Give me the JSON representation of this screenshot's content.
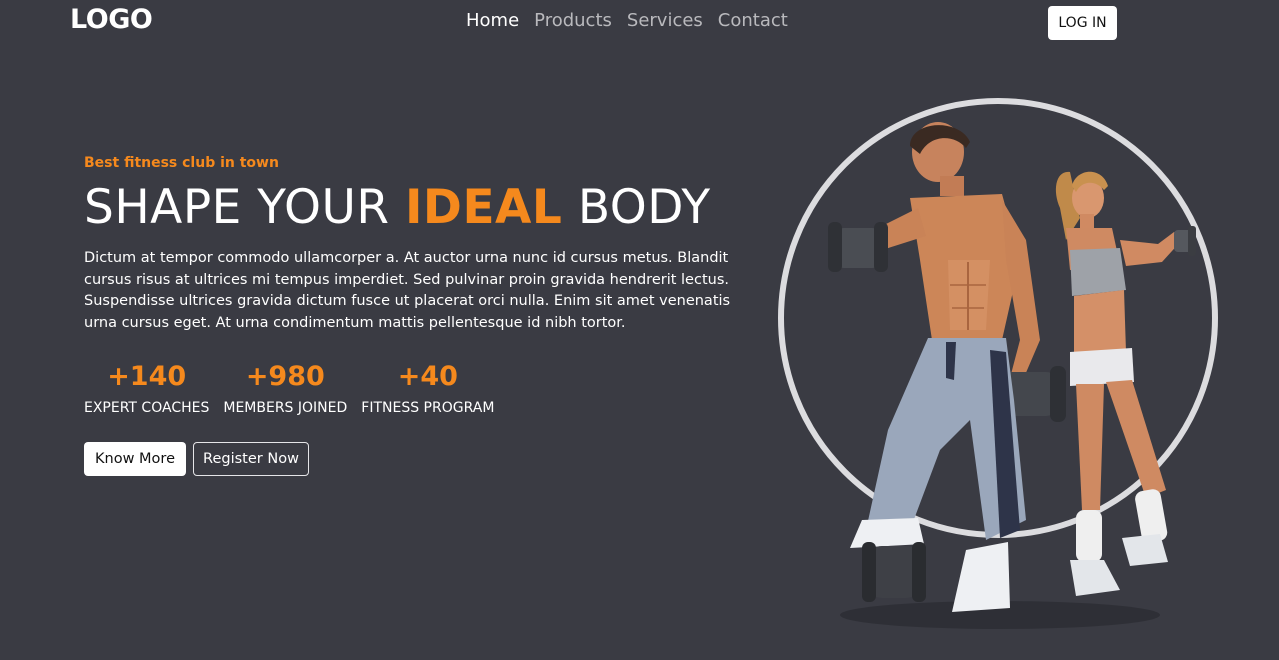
{
  "header": {
    "logo": "LOGO",
    "nav": [
      {
        "label": "Home",
        "active": true
      },
      {
        "label": "Products",
        "active": false
      },
      {
        "label": "Services",
        "active": false
      },
      {
        "label": "Contact",
        "active": false
      }
    ],
    "login_label": "LOG IN"
  },
  "hero": {
    "tagline": "Best fitness club in town",
    "headline_start": "SHAPE YOUR ",
    "headline_accent": "IDEAL",
    "headline_end": " BODY",
    "description": "Dictum at tempor commodo ullamcorper a. At auctor urna nunc id cursus metus. Blandit cursus risus at ultrices mi tempus imperdiet. Sed pulvinar proin gravida hendrerit lectus. Suspendisse ultrices gravida dictum fusce ut placerat orci nulla. Enim sit amet venenatis urna cursus eget. At urna condimentum mattis pellentesque id nibh tortor.",
    "stats": [
      {
        "value": "+140",
        "label": "EXPERT COACHES"
      },
      {
        "value": "+980",
        "label": "MEMBERS JOINED"
      },
      {
        "value": "+40",
        "label": "FITNESS PROGRAM"
      }
    ],
    "primary_button": "Know More",
    "secondary_button": "Register Now",
    "image_subject": "fitness-couple-with-dumbbells"
  },
  "colors": {
    "background": "#3a3b43",
    "accent": "#f5891d",
    "text": "#ffffff",
    "nav_inactive": "#b9b9bd"
  }
}
